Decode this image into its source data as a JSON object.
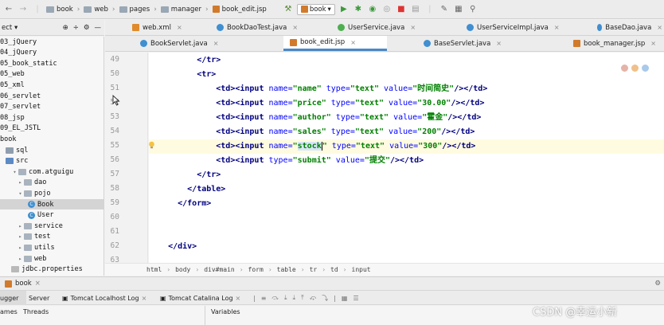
{
  "navbar": {
    "crumbs": [
      "book",
      "web",
      "pages",
      "manager",
      "book_edit.jsp"
    ],
    "run_config": "book",
    "tree_truncated": "ect"
  },
  "project_tree": [
    {
      "label": "03_jQuery",
      "indent": 0,
      "kind": "folder"
    },
    {
      "label": "04_jQuery",
      "indent": 0,
      "kind": "folder"
    },
    {
      "label": "05_book_static",
      "indent": 0,
      "kind": "folder"
    },
    {
      "label": "05_web",
      "indent": 0,
      "kind": "folder"
    },
    {
      "label": "05_xml",
      "indent": 0,
      "kind": "folder"
    },
    {
      "label": "06_servlet",
      "indent": 0,
      "kind": "folder"
    },
    {
      "label": "07_servlet",
      "indent": 0,
      "kind": "folder"
    },
    {
      "label": "08_jsp",
      "indent": 0,
      "kind": "folder"
    },
    {
      "label": "09_EL_JSTL",
      "indent": 0,
      "kind": "folder"
    },
    {
      "label": "book",
      "indent": 0,
      "kind": "folder"
    },
    {
      "label": "sql",
      "indent": 1,
      "kind": "dir"
    },
    {
      "label": "src",
      "indent": 1,
      "kind": "src"
    },
    {
      "label": "com.atguigu",
      "indent": 2,
      "kind": "pkg",
      "open": true
    },
    {
      "label": "dao",
      "indent": 3,
      "kind": "pkg",
      "closed": true
    },
    {
      "label": "pojo",
      "indent": 3,
      "kind": "pkg",
      "open": true
    },
    {
      "label": "Book",
      "indent": 5,
      "kind": "class",
      "selected": true
    },
    {
      "label": "User",
      "indent": 5,
      "kind": "class"
    },
    {
      "label": "service",
      "indent": 3,
      "kind": "pkg",
      "closed": true
    },
    {
      "label": "test",
      "indent": 3,
      "kind": "pkg",
      "closed": true
    },
    {
      "label": "utils",
      "indent": 3,
      "kind": "pkg",
      "closed": true
    },
    {
      "label": "web",
      "indent": 3,
      "kind": "pkg",
      "closed": true
    },
    {
      "label": "jdbc.properties",
      "indent": 2,
      "kind": "file"
    }
  ],
  "tabs_row1": [
    {
      "label": "web.xml",
      "icon": "xml"
    },
    {
      "label": "BookDaoTest.java",
      "icon": "class"
    },
    {
      "label": "UserService.java",
      "icon": "interface"
    },
    {
      "label": "UserServiceImpl.java",
      "icon": "class"
    },
    {
      "label": "BaseDao.java",
      "icon": "class"
    }
  ],
  "tabs_row2": [
    {
      "label": "BookServlet.java",
      "icon": "class"
    },
    {
      "label": "book_edit.jsp",
      "icon": "jsp",
      "active": true
    },
    {
      "label": "BaseServlet.java",
      "icon": "class"
    },
    {
      "label": "book_manager.jsp",
      "icon": "jsp"
    }
  ],
  "editor": {
    "line_numbers": [
      "49",
      "50",
      "51",
      "52",
      "53",
      "54",
      "55",
      "56",
      "57",
      "58",
      "59",
      "60",
      "61",
      "62",
      "63"
    ],
    "lines": [
      {
        "indent": 10,
        "parts": [
          {
            "c": "t",
            "s": "</tr>"
          }
        ]
      },
      {
        "indent": 10,
        "parts": [
          {
            "c": "t",
            "s": "<tr>"
          }
        ]
      },
      {
        "indent": 14,
        "parts": [
          {
            "c": "t",
            "s": "<td><input "
          },
          {
            "c": "an",
            "s": "name="
          },
          {
            "c": "av",
            "s": "\"name\" "
          },
          {
            "c": "an",
            "s": "type="
          },
          {
            "c": "av",
            "s": "\"text\" "
          },
          {
            "c": "an",
            "s": "value="
          },
          {
            "c": "av",
            "s": "\"时间简史\""
          },
          {
            "c": "t",
            "s": "/></td>"
          }
        ]
      },
      {
        "indent": 14,
        "parts": [
          {
            "c": "t",
            "s": "<td><input "
          },
          {
            "c": "an",
            "s": "name="
          },
          {
            "c": "av",
            "s": "\"price\" "
          },
          {
            "c": "an",
            "s": "type="
          },
          {
            "c": "av",
            "s": "\"text\" "
          },
          {
            "c": "an",
            "s": "value="
          },
          {
            "c": "av",
            "s": "\"30.00\""
          },
          {
            "c": "t",
            "s": "/></td>"
          }
        ]
      },
      {
        "indent": 14,
        "parts": [
          {
            "c": "t",
            "s": "<td><input "
          },
          {
            "c": "an",
            "s": "name="
          },
          {
            "c": "av",
            "s": "\"author\" "
          },
          {
            "c": "an",
            "s": "type="
          },
          {
            "c": "av",
            "s": "\"text\" "
          },
          {
            "c": "an",
            "s": "value="
          },
          {
            "c": "av",
            "s": "\"霍金\""
          },
          {
            "c": "t",
            "s": "/></td>"
          }
        ]
      },
      {
        "indent": 14,
        "parts": [
          {
            "c": "t",
            "s": "<td><input "
          },
          {
            "c": "an",
            "s": "name="
          },
          {
            "c": "av",
            "s": "\"sales\" "
          },
          {
            "c": "an",
            "s": "type="
          },
          {
            "c": "av",
            "s": "\"text\" "
          },
          {
            "c": "an",
            "s": "value="
          },
          {
            "c": "av",
            "s": "\"200\""
          },
          {
            "c": "t",
            "s": "/></td>"
          }
        ]
      },
      {
        "indent": 14,
        "current": true,
        "parts": [
          {
            "c": "t",
            "s": "<td><input "
          },
          {
            "c": "an",
            "s": "name="
          },
          {
            "c": "av",
            "s": "\""
          },
          {
            "c": "av hl",
            "s": "stock"
          },
          {
            "c": "caret",
            "s": ""
          },
          {
            "c": "av",
            "s": "\" "
          },
          {
            "c": "an",
            "s": "type="
          },
          {
            "c": "av",
            "s": "\"text\" "
          },
          {
            "c": "an",
            "s": "value="
          },
          {
            "c": "av",
            "s": "\"300\""
          },
          {
            "c": "t",
            "s": "/></td>"
          }
        ]
      },
      {
        "indent": 14,
        "parts": [
          {
            "c": "t",
            "s": "<td><input "
          },
          {
            "c": "an",
            "s": "type="
          },
          {
            "c": "av",
            "s": "\"submit\" "
          },
          {
            "c": "an",
            "s": "value="
          },
          {
            "c": "av",
            "s": "\"提交\""
          },
          {
            "c": "t",
            "s": "/></td>"
          }
        ]
      },
      {
        "indent": 10,
        "parts": [
          {
            "c": "t",
            "s": "</tr>"
          }
        ]
      },
      {
        "indent": 8,
        "parts": [
          {
            "c": "t",
            "s": "</table>"
          }
        ]
      },
      {
        "indent": 6,
        "parts": [
          {
            "c": "t",
            "s": "</form>"
          }
        ]
      },
      {
        "indent": 0,
        "parts": []
      },
      {
        "indent": 0,
        "parts": []
      },
      {
        "indent": 4,
        "parts": [
          {
            "c": "t",
            "s": "</div>"
          }
        ]
      },
      {
        "indent": 0,
        "parts": []
      }
    ]
  },
  "breadcrumb": [
    "html",
    "body",
    "div#main",
    "form",
    "table",
    "tr",
    "td",
    "input"
  ],
  "run_bar": {
    "label": "book"
  },
  "debug_tabs": [
    {
      "label": "ugger"
    },
    {
      "label": "Server"
    },
    {
      "label": "Tomcat Localhost Log"
    },
    {
      "label": "Tomcat Catalina Log"
    }
  ],
  "panels": {
    "frames": "ames",
    "threads": "Threads",
    "variables": "Variables"
  },
  "watermark": "CSDN @幸运小新",
  "colors": {
    "tag": "#000080",
    "attr_name": "#0000ff",
    "attr_value": "#008000",
    "active_tab": "#4a88c7"
  }
}
